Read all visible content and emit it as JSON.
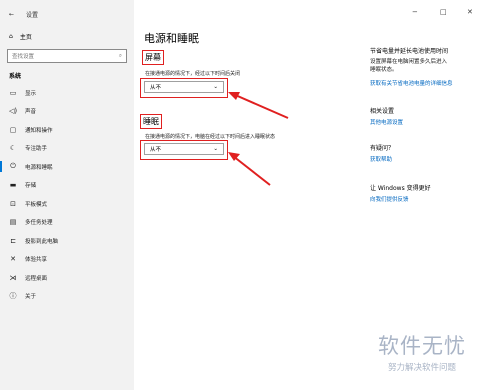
{
  "window": {
    "title": "设置",
    "back_glyph": "←",
    "controls": [
      "−",
      "□",
      "✕"
    ]
  },
  "sidebar": {
    "home": "主页",
    "search_placeholder": "查找设置",
    "section": "系统",
    "items": [
      {
        "icon": "display-icon",
        "glyph": "▭",
        "label": "显示"
      },
      {
        "icon": "sound-icon",
        "glyph": "◁)",
        "label": "声音"
      },
      {
        "icon": "notification-icon",
        "glyph": "▢",
        "label": "通知和操作"
      },
      {
        "icon": "focus-assist-icon",
        "glyph": "☾",
        "label": "专注助手"
      },
      {
        "icon": "power-icon",
        "glyph": "⏻",
        "label": "电源和睡眠",
        "active": true
      },
      {
        "icon": "storage-icon",
        "glyph": "▬",
        "label": "存储"
      },
      {
        "icon": "tablet-mode-icon",
        "glyph": "⊡",
        "label": "平板模式"
      },
      {
        "icon": "multitasking-icon",
        "glyph": "▤",
        "label": "多任务处理"
      },
      {
        "icon": "projection-icon",
        "glyph": "⊏",
        "label": "投影到此电脑"
      },
      {
        "icon": "shared-experiences-icon",
        "glyph": "✕",
        "label": "体验共享"
      },
      {
        "icon": "remote-desktop-icon",
        "glyph": "⋊",
        "label": "远程桌面"
      },
      {
        "icon": "about-icon",
        "glyph": "ⓘ",
        "label": "关于"
      }
    ]
  },
  "main": {
    "title": "电源和睡眠",
    "screen": {
      "heading": "屏幕",
      "desc": "在接通电源的情况下，经过以下时间后关闭",
      "value": "从不"
    },
    "sleep": {
      "heading": "睡眠",
      "desc": "在接通电源的情况下，电脑在经过以下时间后进入睡眠状态",
      "value": "从不"
    }
  },
  "right_panel": {
    "energy": {
      "title": "节省电量并延长电池使用时间",
      "desc_line1": "设置屏幕在电脑闲置多久后进入",
      "desc_line2": "睡眠状态。",
      "link": "获取有关节省电池电量的详细信息"
    },
    "related": {
      "title": "相关设置",
      "link": "其他电源设置"
    },
    "help": {
      "title": "有疑问？",
      "link": "获取帮助"
    },
    "feedback": {
      "title": "让 Windows 变得更好",
      "link": "向我们提供反馈"
    }
  },
  "watermark": {
    "line1": "软件无忧",
    "line2": "努力解决软件问题"
  }
}
